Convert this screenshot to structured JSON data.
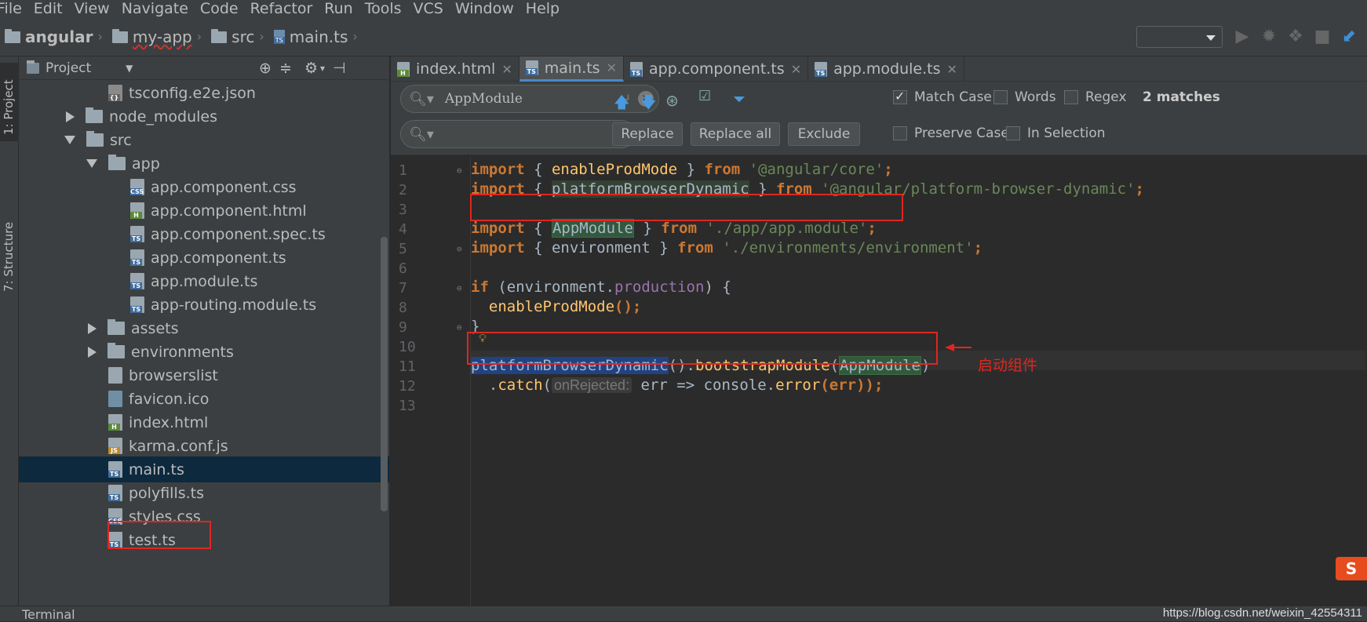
{
  "menu": [
    "File",
    "Edit",
    "View",
    "Navigate",
    "Code",
    "Refactor",
    "Run",
    "Tools",
    "VCS",
    "Window",
    "Help"
  ],
  "breadcrumb": [
    "angular",
    "my-app",
    "src",
    "main.ts"
  ],
  "side_tabs": {
    "project": "1: Project",
    "structure": "7: Structure"
  },
  "project_panel": {
    "title": "Project",
    "items": [
      {
        "label": "tsconfig.e2e.json",
        "icon": "json-file-icon"
      },
      {
        "label": "node_modules",
        "icon": "folder-icon"
      },
      {
        "label": "src",
        "icon": "folder-icon"
      },
      {
        "label": "app",
        "icon": "folder-icon"
      },
      {
        "label": "app.component.css",
        "icon": "css-file-icon"
      },
      {
        "label": "app.component.html",
        "icon": "html-file-icon"
      },
      {
        "label": "app.component.spec.ts",
        "icon": "ts-spec-file-icon"
      },
      {
        "label": "app.component.ts",
        "icon": "ts-file-icon"
      },
      {
        "label": "app.module.ts",
        "icon": "ts-file-icon"
      },
      {
        "label": "app-routing.module.ts",
        "icon": "ts-file-icon"
      },
      {
        "label": "assets",
        "icon": "folder-icon"
      },
      {
        "label": "environments",
        "icon": "folder-icon"
      },
      {
        "label": "browserslist",
        "icon": "file-icon"
      },
      {
        "label": "favicon.ico",
        "icon": "image-file-icon"
      },
      {
        "label": "index.html",
        "icon": "html-file-icon"
      },
      {
        "label": "karma.conf.js",
        "icon": "js-file-icon"
      },
      {
        "label": "main.ts",
        "icon": "ts-file-icon"
      },
      {
        "label": "polyfills.ts",
        "icon": "ts-file-icon"
      },
      {
        "label": "styles.css",
        "icon": "css-file-icon"
      },
      {
        "label": "test.ts",
        "icon": "ts-file-icon"
      }
    ]
  },
  "tabs": [
    {
      "label": "index.html"
    },
    {
      "label": "main.ts"
    },
    {
      "label": "app.component.ts"
    },
    {
      "label": "app.module.ts"
    }
  ],
  "find": {
    "query": "AppModule",
    "replace": "",
    "replace_btn": "Replace",
    "replace_all_btn": "Replace all",
    "exclude_btn": "Exclude",
    "match_case": "Match Case",
    "words": "Words",
    "regex": "Regex",
    "matches": "2 matches",
    "preserve_case": "Preserve Case",
    "in_selection": "In Selection"
  },
  "line_numbers": [
    "1",
    "2",
    "3",
    "4",
    "5",
    "6",
    "7",
    "8",
    "9",
    "10",
    "11",
    "12",
    "13"
  ],
  "code": {
    "l1": {
      "kw": "import",
      "a": " { ",
      "fn": "enableProdMode",
      "b": " } ",
      "kw2": "from",
      "str": " '@angular/core'",
      "end": ";"
    },
    "l2": {
      "kw": "import",
      "a": " { ",
      "id": "platformBrowserDynamic",
      "b": " } ",
      "kw2": "from",
      "str": " '@angular/platform-browser-dynamic'",
      "end": ";"
    },
    "l4": {
      "kw": "import",
      "a": " { ",
      "id": "AppModule",
      "b": " } ",
      "kw2": "from",
      "str": " './app/app.module'",
      "end": ";"
    },
    "l5": {
      "kw": "import",
      "a": " { environment } ",
      "kw2": "from",
      "str": " './environments/environment'",
      "end": ";"
    },
    "l7": {
      "kw": "if",
      "a": " (environment.",
      "prop": "production",
      "b": ") {"
    },
    "l8": {
      "fn": "enableProdMode",
      "end": "();"
    },
    "l9": {
      "a": "}"
    },
    "l11": {
      "sel": "platformBrowserDynamic",
      "a": "().",
      "fn": "bootstrapModule",
      "b": "(",
      "id": "AppModule",
      "end": ")"
    },
    "l12": {
      "a": ".",
      "fn": "catch",
      "b": "(",
      "hint": "onRejected:",
      "c": " err => console.",
      "fn2": "error",
      "end": "(err));"
    }
  },
  "annotation": "启动组件",
  "statusbar": {
    "terminal": "Terminal",
    "watermark": "https://blog.csdn.net/weixin_42554311"
  }
}
